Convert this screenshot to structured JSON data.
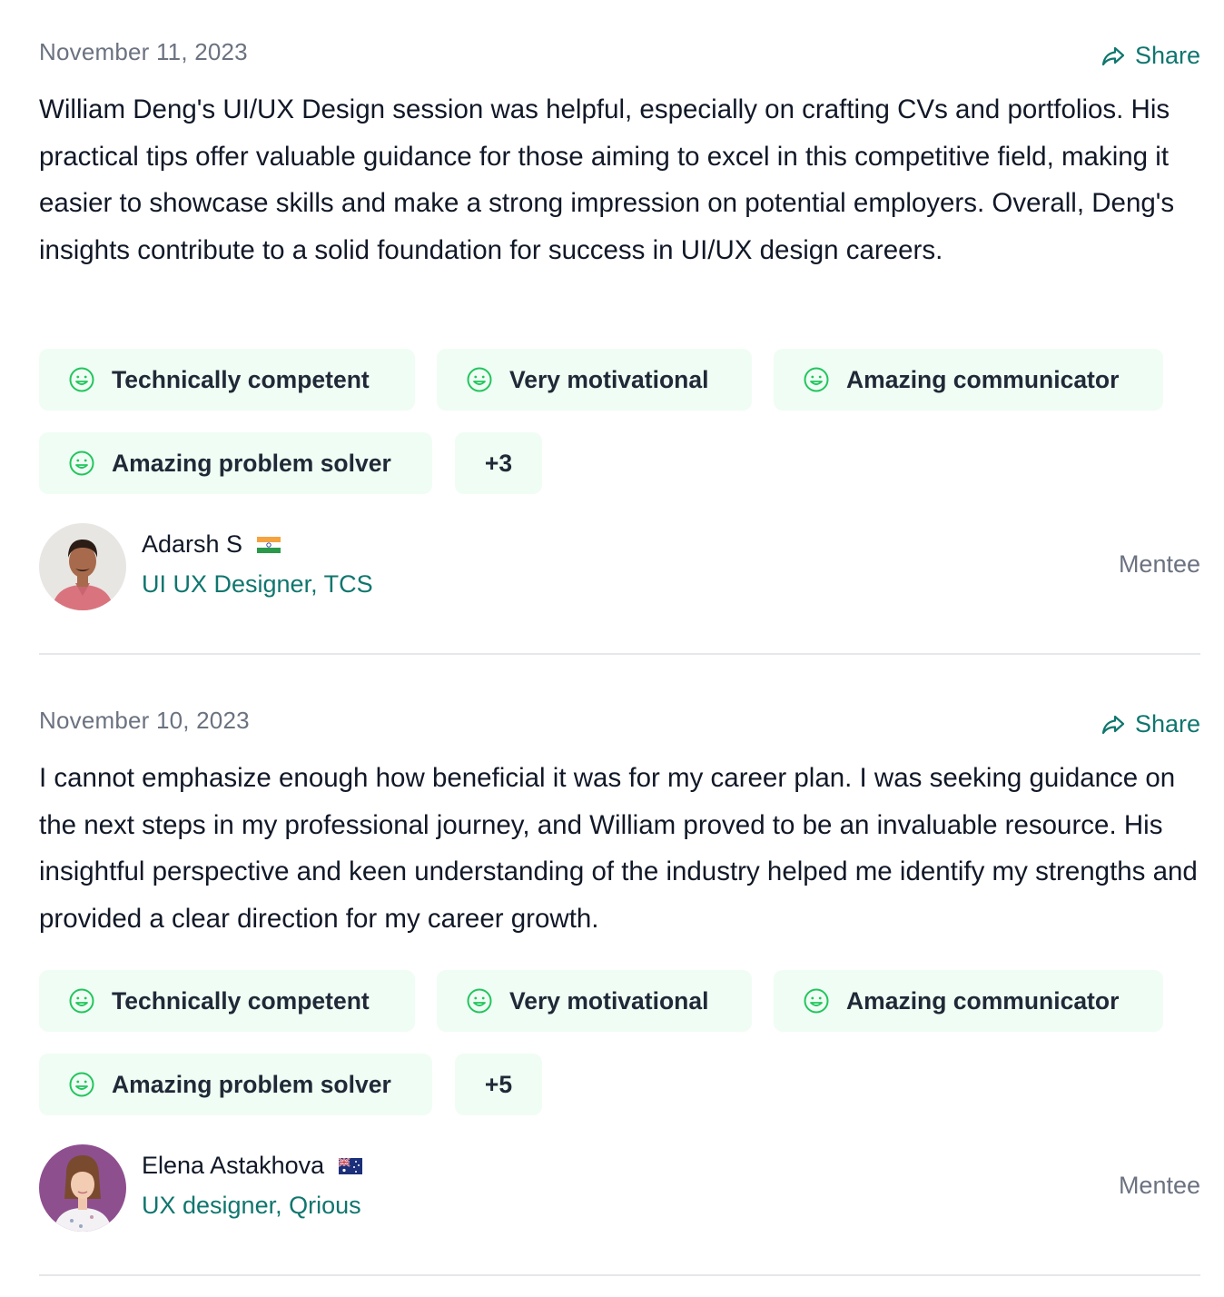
{
  "reviews": [
    {
      "date": "November 11, 2023",
      "share_label": "Share",
      "text": "William Deng's UI/UX Design session was helpful, especially on crafting CVs and portfolios. His practical tips offer valuable guidance for those aiming to excel in this competitive field, making it easier to showcase skills and make a strong impression on potential employers. Overall, Deng's insights contribute to a solid foundation for success in UI/UX design careers.",
      "tags": [
        "Technically competent",
        "Very motivational",
        "Amazing communicator",
        "Amazing problem solver"
      ],
      "more_tags": "+3",
      "author": {
        "name": "Adarsh S",
        "flag_icon": "india-flag-icon",
        "role": "UI UX Designer, TCS",
        "relation": "Mentee"
      }
    },
    {
      "date": "November 10, 2023",
      "share_label": "Share",
      "text": "I cannot emphasize enough how beneficial it was for my career plan. I was seeking guidance on the next steps in my professional journey, and William proved to be an invaluable resource. His insightful perspective and keen understanding of the industry helped me identify my strengths and provided a clear direction for my career growth.",
      "tags": [
        "Technically competent",
        "Very motivational",
        "Amazing communicator",
        "Amazing problem solver"
      ],
      "more_tags": "+5",
      "author": {
        "name": "Elena Astakhova",
        "flag_icon": "australia-flag-icon",
        "role": "UX designer, Qrious",
        "relation": "Mentee"
      }
    }
  ],
  "colors": {
    "accent": "#0f766e",
    "tag_background": "#f0fdf4",
    "smile_icon": "#22c55e",
    "muted_text": "#6b7280"
  }
}
